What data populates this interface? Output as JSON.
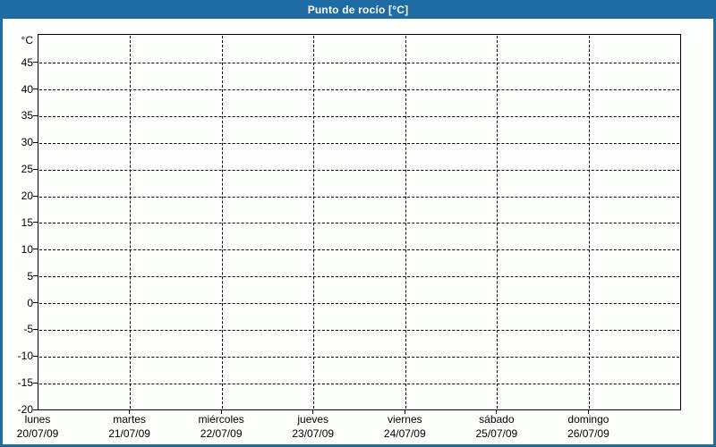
{
  "window": {
    "title": "Punto de rocío [°C]"
  },
  "chart_data": {
    "type": "line",
    "title": "Punto de rocío [°C]",
    "xlabel": "",
    "ylabel": "°C",
    "ylim": [
      -20,
      50.3
    ],
    "grid": "dashed",
    "legend": "none",
    "series": [],
    "y_axis": {
      "unit": "°C",
      "min": -20,
      "max": 50.3,
      "tick_step": 5,
      "tick_labels": [
        45,
        40,
        35,
        30,
        25,
        20,
        15,
        10,
        5,
        0,
        -5,
        -10,
        -15,
        -20
      ]
    },
    "x_axis": {
      "categories": [
        "lunes",
        "martes",
        "miércoles",
        "jueves",
        "viernes",
        "sábado",
        "domingo"
      ],
      "dates": [
        "20/07/09",
        "21/07/09",
        "22/07/09",
        "23/07/09",
        "24/07/09",
        "25/07/09",
        "26/07/09"
      ]
    },
    "colors": {
      "header_bg": "#1e6ca3",
      "header_text": "#ffffff",
      "plot_bg": "#fcfefc",
      "axis": "#000000",
      "grid": "#000000"
    }
  }
}
